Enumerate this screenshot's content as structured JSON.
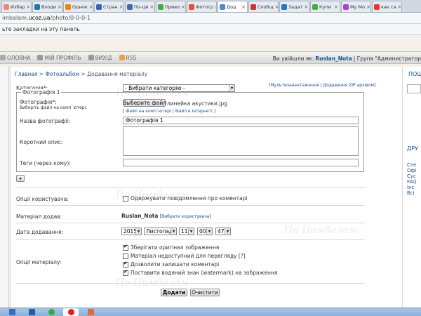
{
  "browser": {
    "tabs": [
      {
        "label": "Избар",
        "favicon": "#e87"
      },
      {
        "label": "Входи",
        "favicon": "#27a"
      },
      {
        "label": "Однок",
        "favicon": "#e80"
      },
      {
        "label": "Стран",
        "favicon": "#36b"
      },
      {
        "label": "По-Ци",
        "favicon": "#46a"
      },
      {
        "label": "Приво",
        "favicon": "#4a4"
      },
      {
        "label": "Фотогр",
        "favicon": "#d53"
      },
      {
        "label": "Дод",
        "favicon": "#58c",
        "active": true
      },
      {
        "label": "Сообщ",
        "favicon": "#c33"
      },
      {
        "label": "Задат",
        "favicon": "#27c"
      },
      {
        "label": "Купи",
        "favicon": "#4a4"
      },
      {
        "label": "My Mo",
        "favicon": "#a4c"
      },
      {
        "label": "как са",
        "favicon": "#e33"
      }
    ],
    "address_prefix": "imbalam.",
    "address_domain": "ucoz.ua",
    "address_path": "/photo/0-0-0-1",
    "bookmarks_text": "ьте закладки на эту панель"
  },
  "site_nav": {
    "items": [
      "ОЛОВНА",
      "МІЙ ПРОФІЛЬ",
      "ВИХІД",
      "RSS"
    ],
    "logged_in_prefix": "Ви увійшли як:",
    "username": "Ruslan_Nota",
    "group_text": "| Група \"Администратор"
  },
  "breadcrumb": {
    "home": "Главная",
    "album": "Фотоальбом",
    "current": "Додавання матеріалу"
  },
  "form": {
    "category_label": "Категорія",
    "category_value": "- Вибрати категорію -",
    "multi_upload": "Мультизавантаження",
    "zip_upload": "Додавання ZIP архівом",
    "photo_legend": "Фотографія 1",
    "photo_label": "Фотографія",
    "photo_hint": "Виберіть файл на комп`ютері.",
    "choose_file": "Выберите файл",
    "file_name": "линейка акустики.jpg",
    "file_local_link": "Файл на комп`ютері",
    "file_web_link": "Файл в інтернеті",
    "photo_name_label": "Назва фотографії:",
    "photo_name_value": "Фотографія 1",
    "short_desc_label": "Короткий опис:",
    "tags_label": "Теги (через кому):",
    "add_photo_button": "+",
    "user_opts_label": "Опції користувача:",
    "notify_label": "Одержувати повідомлення про коментарі",
    "added_by_label": "Матеріал додав:",
    "added_by_value": "Ruslan_Nota",
    "choose_user_link": "Вибрати користувача",
    "date_label": "Дата додавання:",
    "date": {
      "year": "2015",
      "month": "Листопад",
      "day": "11",
      "hour": "00",
      "minute": "47"
    },
    "material_opts_label": "Опції матеріалу:",
    "options": [
      {
        "label": "Зберігати оригінал зображення",
        "checked": true
      },
      {
        "label": "Матеріал недоступний для перегляду [?]",
        "checked": false
      },
      {
        "label": "Дозволити залишати коментарі",
        "checked": true
      },
      {
        "label": "Поставити водяний знак (watermark) на зображення",
        "checked": true
      }
    ],
    "submit_label": "Додати",
    "clear_label": "Очистити"
  },
  "sidebar_right": {
    "header1": "ПОШ",
    "header2": "ДРУ",
    "links": [
      "Сте",
      "Офі",
      "Сус",
      "FAQ",
      "Інс",
      "Всі"
    ]
  },
  "watermark_text": "По Цимбалам"
}
